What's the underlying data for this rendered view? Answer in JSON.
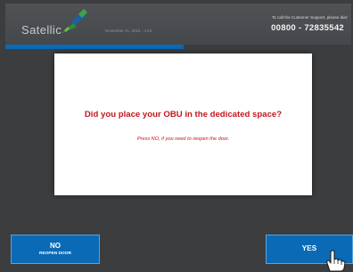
{
  "header": {
    "logo_text": "Satellic",
    "date_time": "November 21, 2016 · 4:10",
    "support_label": "To call the Customer Support, please dial:",
    "support_phone": "00800 - 72835542"
  },
  "dialog": {
    "question": "Did you place your OBU in the dedicated space?",
    "hint": "Press NO, if you need to reopen the door."
  },
  "buttons": {
    "no_label": "NO",
    "no_sublabel": "REOPEN DOOR",
    "yes_label": "YES"
  },
  "colors": {
    "accent_blue": "#0b6ab6",
    "alert_red": "#c4161c",
    "background": "#3b3d3f"
  },
  "icons": {
    "logo_mark": "satellite-logo-icon",
    "cursor": "hand-pointer-icon"
  }
}
